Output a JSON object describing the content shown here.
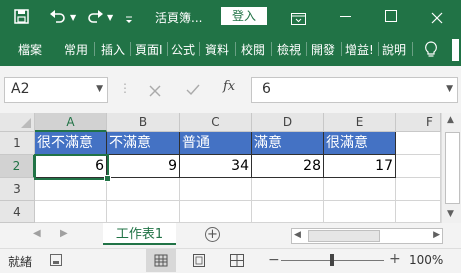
{
  "titlebar": {
    "title": "活頁簿...",
    "login": "登入",
    "icons": [
      "save-icon",
      "undo-icon",
      "redo-icon",
      "customize-qat-icon",
      "ribbon-display-icon",
      "minimize-icon",
      "restore-icon",
      "close-icon"
    ]
  },
  "ribbon": {
    "tabs": [
      "檔案",
      "常用",
      "插入",
      "頁面I",
      "公式",
      "資料",
      "校閱",
      "檢視",
      "開發",
      "增益!",
      "說明"
    ],
    "lightbulb_icon": "lightbulb-icon"
  },
  "formula_bar": {
    "name_box": "A2",
    "formula": "6",
    "fx": "fx"
  },
  "sheet": {
    "columns": [
      "A",
      "B",
      "C",
      "D",
      "E",
      "F"
    ],
    "rows": [
      "1",
      "2",
      "3",
      "4"
    ],
    "headers": [
      "很不滿意",
      "不滿意",
      "普通",
      "滿意",
      "很滿意"
    ],
    "values": [
      "6",
      "9",
      "34",
      "28",
      "17"
    ]
  },
  "tabs": {
    "sheet_tab": "工作表1"
  },
  "status": {
    "ready": "就緒",
    "zoom": "100%"
  },
  "colors": {
    "excel_green": "#217346",
    "header_fill": "#4472c4"
  }
}
